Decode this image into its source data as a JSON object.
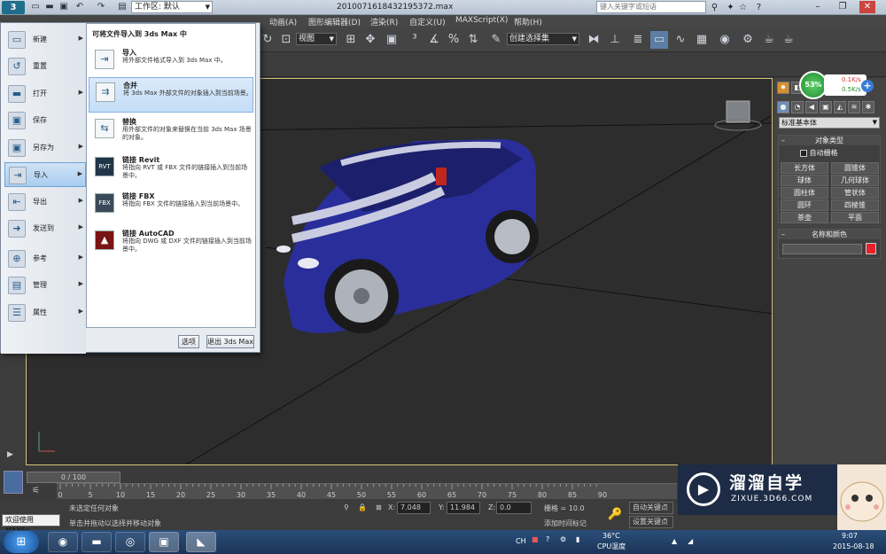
{
  "window": {
    "title": "2010071618432195372.max",
    "workspace": "工作区: 默认",
    "search_placeholder": "键入关键字或短语"
  },
  "menubar": [
    "动画(A)",
    "图形编辑器(D)",
    "渲染(R)",
    "自定义(U)",
    "MAXScript(X)",
    "帮助(H)"
  ],
  "toolbar": {
    "view_combo": "视图",
    "selection_set_combo": "创建选择集"
  },
  "app_menu": {
    "items": [
      {
        "label": "新建"
      },
      {
        "label": "重置"
      },
      {
        "label": "打开"
      },
      {
        "label": "保存"
      },
      {
        "label": "另存为"
      },
      {
        "label": "导入"
      },
      {
        "label": "导出"
      },
      {
        "label": "发送到"
      },
      {
        "label": "参考"
      },
      {
        "label": "管理"
      },
      {
        "label": "属性"
      }
    ],
    "header": "可将文件导入到 3ds Max 中",
    "sub_items": [
      {
        "title": "导入",
        "desc": "将外部文件格式导入到 3ds Max 中。",
        "icon": "import-icon"
      },
      {
        "title": "合并",
        "desc": "将 3ds Max 外部文件的对象插入到当前场景。",
        "icon": "merge-icon"
      },
      {
        "title": "替换",
        "desc": "用外部文件的对象来替换在当前 3ds Max 场景的对象。",
        "icon": "replace-icon"
      },
      {
        "title": "链接 Revit",
        "desc": "将指向 RVT 或 FBX 文件的链接插入到当前场景中。",
        "icon": "revit-icon"
      },
      {
        "title": "链接 FBX",
        "desc": "将指向 FBX 文件的链接插入到当前场景中。",
        "icon": "fbx-icon"
      },
      {
        "title": "链接 AutoCAD",
        "desc": "将指向 DWG 或 DXF 文件的链接插入到当前场景中。",
        "icon": "autocad-icon"
      }
    ],
    "options_button": "选项",
    "exit_button": "退出 3ds Max"
  },
  "command_panel": {
    "category_combo": "标准基本体",
    "object_type_header": "对象类型",
    "auto_grid": "自动栅格",
    "object_buttons": [
      "长方体",
      "圆锥体",
      "球体",
      "几何球体",
      "圆柱体",
      "管状体",
      "圆环",
      "四棱锥",
      "茶壶",
      "平面"
    ],
    "name_color_header": "名称和颜色",
    "accent": "#e8202a"
  },
  "gauge": {
    "percent": "53%",
    "up": "0.1K/s",
    "down": "0.5K/s"
  },
  "timeline": {
    "slider": "0 / 100",
    "ticks": [
      "0",
      "5",
      "10",
      "15",
      "20",
      "25",
      "30",
      "35",
      "40",
      "45",
      "50",
      "55",
      "60",
      "65",
      "70",
      "75",
      "80",
      "85",
      "90"
    ]
  },
  "status": {
    "welcome": "欢迎使用 MAXSc",
    "line1": "未选定任何对象",
    "line2": "单击并拖动以选择并移动对象",
    "x_label": "X:",
    "x_value": "7.048",
    "y_label": "Y:",
    "y_value": "11.984",
    "z_label": "Z:",
    "z_value": "0.0",
    "grid": "栅格 = 10.0",
    "add_time_tag": "添加时间标记",
    "auto_key": "自动关键点",
    "set_key": "设置关键点"
  },
  "taskbar": {
    "ime": "CH",
    "temp": "36°C",
    "cpu": "CPU温度",
    "time": "9:07",
    "date": "2015-08-18"
  },
  "watermark": {
    "brand": "溜溜自学",
    "url": "ZIXUE.3D66.COM"
  }
}
